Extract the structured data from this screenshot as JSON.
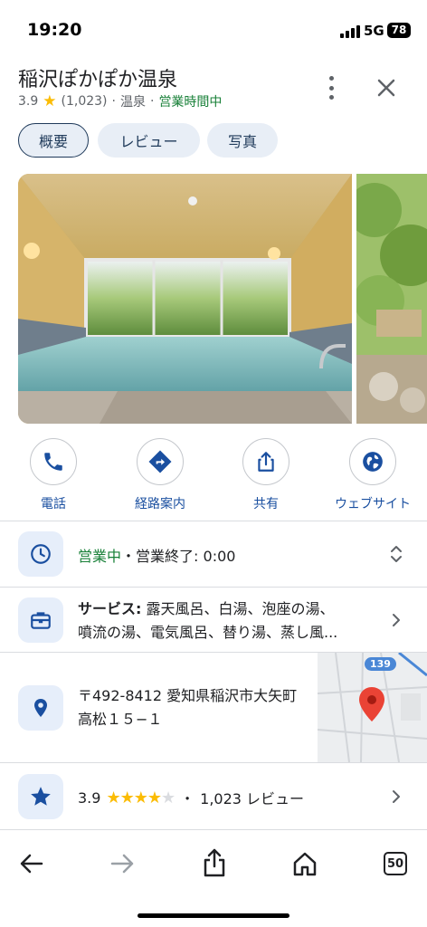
{
  "status_bar": {
    "time": "19:20",
    "network": "5G",
    "battery": "78"
  },
  "place": {
    "name": "稲沢ぽかぽか温泉",
    "rating": "3.9",
    "review_count": "(1,023)",
    "category": "温泉",
    "open_status": "営業時間中"
  },
  "tabs": [
    {
      "label": "概要"
    },
    {
      "label": "レビュー"
    },
    {
      "label": "写真"
    }
  ],
  "actions": [
    {
      "label": "電話",
      "icon": "phone-icon"
    },
    {
      "label": "経路案内",
      "icon": "directions-icon"
    },
    {
      "label": "共有",
      "icon": "share-icon"
    },
    {
      "label": "ウェブサイト",
      "icon": "globe-icon"
    }
  ],
  "hours": {
    "status": "営業中",
    "sep": "・",
    "closing": "営業終了: 0:00"
  },
  "services": {
    "heading": "サービス:",
    "line1": "露天風呂、白湯、泡座の湯、",
    "line2": "噴流の湯、電気風呂、替り湯、蒸し風..."
  },
  "address": {
    "line1": "〒492-8412 愛知県稲沢市大矢町",
    "line2": "高松１５−１",
    "map_route": "139"
  },
  "reviews_row": {
    "rating": "3.9",
    "stars": 4,
    "dot": "・",
    "count_text": "1,023 レビュー"
  },
  "browser_nav": {
    "tab_count": "50"
  },
  "colors": {
    "accent": "#1a4fa0",
    "open_green": "#188038",
    "icon_bg": "#e6eefa",
    "star": "#fbbc04",
    "pin": "#ea4335"
  }
}
